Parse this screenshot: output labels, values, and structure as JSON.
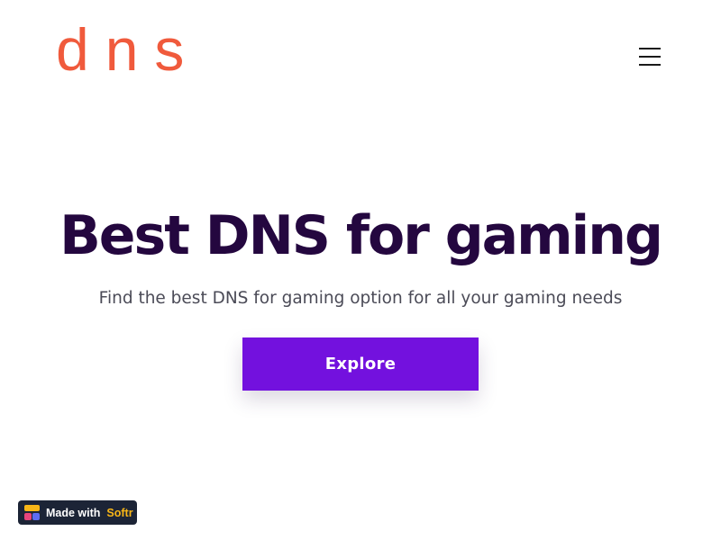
{
  "header": {
    "logo_text": "dns",
    "logo_color": "#f05a3c",
    "menu_icon": "hamburger-menu-icon"
  },
  "hero": {
    "title": "Best DNS for gaming",
    "subtitle": "Find the best DNS for gaming option for all your gaming needs",
    "button_label": "Explore",
    "title_color": "#24073f",
    "button_color": "#7311de"
  },
  "badge": {
    "made_with": "Made with",
    "brand": "Softr",
    "brand_color": "#f8b617",
    "icon": "softr-logo-icon"
  }
}
